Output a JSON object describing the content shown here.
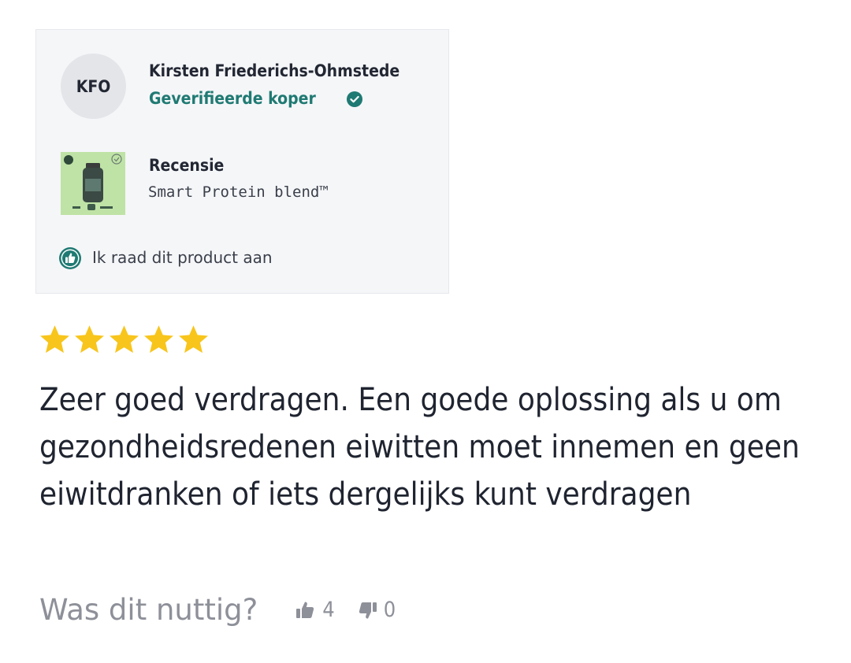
{
  "reviewer": {
    "initials": "KFO",
    "name": "Kirsten Friederichs-Ohmstede",
    "verified_label": "Geverifieerde koper"
  },
  "product": {
    "section_label": "Recensie",
    "name": "Smart Protein blend™"
  },
  "recommendation": "Ik raad dit product aan",
  "rating": {
    "stars": 5,
    "max": 5
  },
  "review_text": "Zeer goed verdragen. Een goede oplossing als u om gezondheidsredenen eiwitten moet innemen en geen eiwitdranken of iets dergelijks kunt verdragen",
  "helpful": {
    "label": "Was dit nuttig?",
    "up_count": "4",
    "down_count": "0"
  },
  "colors": {
    "accent": "#1f7a73",
    "star": "#f8c51c",
    "card_bg": "#f5f6f8"
  }
}
